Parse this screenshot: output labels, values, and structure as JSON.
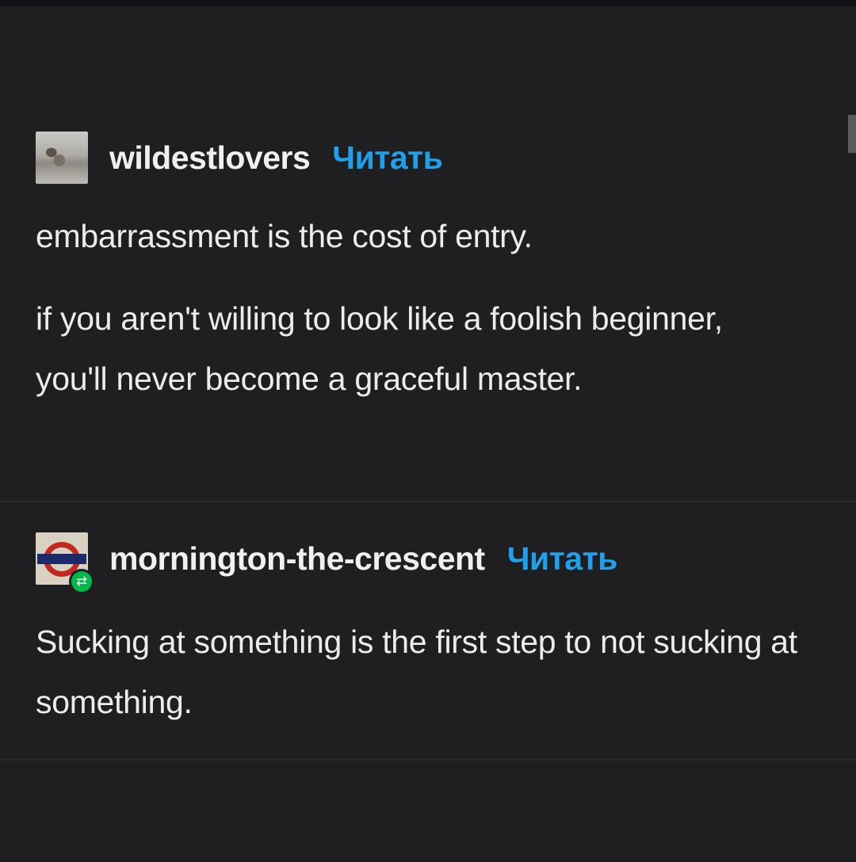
{
  "colors": {
    "background": "#1f1f21",
    "text": "#ececec",
    "follow_link": "#1fa0e8",
    "reblog_badge": "#00b84a"
  },
  "posts": [
    {
      "avatar_icon": "landscape-photo-avatar",
      "username": "wildestlovers",
      "follow_label": "Читать",
      "paragraphs": [
        "embarrassment is the cost of entry.",
        "if you aren't willing to look like a foolish beginner, you'll never become a graceful master."
      ]
    },
    {
      "avatar_icon": "underground-roundel-avatar",
      "badge_icon": "reblog-icon",
      "username": "mornington-the-crescent",
      "follow_label": "Читать",
      "paragraphs": [
        "Sucking at something is the first step to not sucking at something."
      ]
    }
  ]
}
